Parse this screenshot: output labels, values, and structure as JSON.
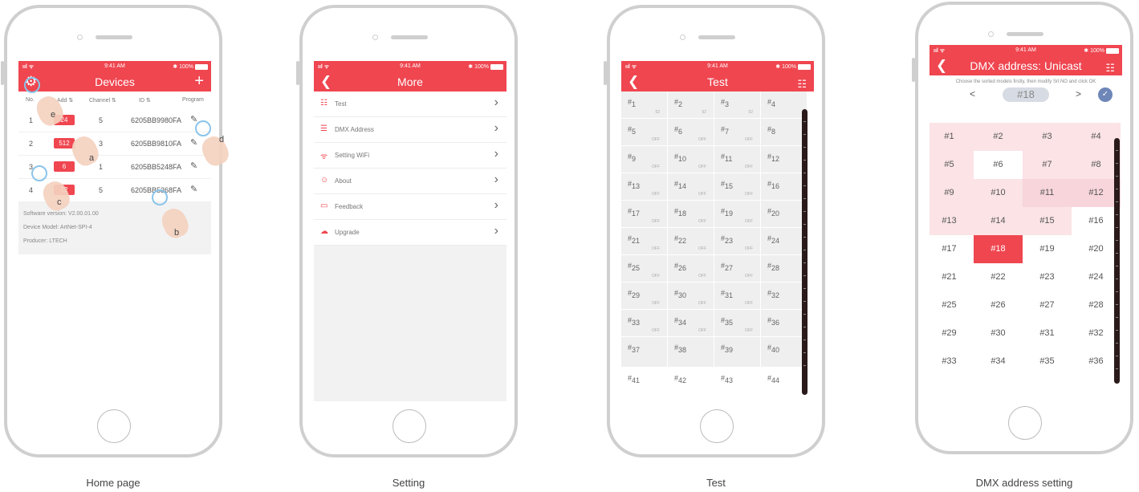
{
  "status": {
    "signal": "ııl ᯤ",
    "time": "9:41 AM",
    "battery": "✱ 100%"
  },
  "home": {
    "caption": "Home page",
    "title": "Devices",
    "col_no": "No.",
    "col_add": "Add ⇅",
    "col_channel": "Channel ⇅",
    "col_id": "ID ⇅",
    "col_program": "Program",
    "devices": [
      {
        "no": "1",
        "addr": "24",
        "channel": "5",
        "id": "6205BB9980FA"
      },
      {
        "no": "2",
        "addr": "512",
        "channel": "3",
        "id": "6205BB9810FA"
      },
      {
        "no": "3",
        "addr": "6",
        "channel": "1",
        "id": "6205BB5248FA"
      },
      {
        "no": "4",
        "addr": "12",
        "channel": "5",
        "id": "6205BB5368FA"
      }
    ],
    "software": "Software version:  V2.00.01.00",
    "model": "Device Model:  ArtNet-SPI-4",
    "producer": "Producer:  LTECH",
    "tags": {
      "a": "a",
      "b": "b",
      "c": "c",
      "d": "d",
      "e": "e"
    }
  },
  "setting": {
    "caption": "Setting",
    "title": "More",
    "items": [
      {
        "label": "Test",
        "icon": "☷"
      },
      {
        "label": "DMX Address",
        "icon": "☰"
      },
      {
        "label": "Setting WiFi",
        "icon": "ᯤ"
      },
      {
        "label": "About",
        "icon": "☺"
      },
      {
        "label": "Feedback",
        "icon": "▭"
      },
      {
        "label": "Upgrade",
        "icon": "☁"
      }
    ]
  },
  "test": {
    "caption": "Test",
    "title": "Test",
    "cells": [
      {
        "n": "1",
        "v": "52"
      },
      {
        "n": "2",
        "v": "52"
      },
      {
        "n": "3",
        "v": "52"
      },
      {
        "n": "4",
        "v": ""
      },
      {
        "n": "5",
        "v": "OFF"
      },
      {
        "n": "6",
        "v": "OFF"
      },
      {
        "n": "7",
        "v": "OFF"
      },
      {
        "n": "8",
        "v": ""
      },
      {
        "n": "9",
        "v": "OFF"
      },
      {
        "n": "10",
        "v": "OFF"
      },
      {
        "n": "11",
        "v": "OFF"
      },
      {
        "n": "12",
        "v": ""
      },
      {
        "n": "13",
        "v": "OFF"
      },
      {
        "n": "14",
        "v": "OFF"
      },
      {
        "n": "15",
        "v": "OFF"
      },
      {
        "n": "16",
        "v": ""
      },
      {
        "n": "17",
        "v": "OFF"
      },
      {
        "n": "18",
        "v": "OFF"
      },
      {
        "n": "19",
        "v": "OFF"
      },
      {
        "n": "20",
        "v": ""
      },
      {
        "n": "21",
        "v": "OFF"
      },
      {
        "n": "22",
        "v": "OFF"
      },
      {
        "n": "23",
        "v": "OFF"
      },
      {
        "n": "24",
        "v": ""
      },
      {
        "n": "25",
        "v": "OFF"
      },
      {
        "n": "26",
        "v": "OFF"
      },
      {
        "n": "27",
        "v": "OFF"
      },
      {
        "n": "28",
        "v": ""
      },
      {
        "n": "29",
        "v": "OFF"
      },
      {
        "n": "30",
        "v": "OFF"
      },
      {
        "n": "31",
        "v": "OFF"
      },
      {
        "n": "32",
        "v": ""
      },
      {
        "n": "33",
        "v": "OFF"
      },
      {
        "n": "34",
        "v": "OFF"
      },
      {
        "n": "35",
        "v": "OFF"
      },
      {
        "n": "36",
        "v": ""
      },
      {
        "n": "37",
        "v": ""
      },
      {
        "n": "38",
        "v": ""
      },
      {
        "n": "39",
        "v": ""
      },
      {
        "n": "40",
        "v": ""
      },
      {
        "n": "41",
        "v": ""
      },
      {
        "n": "42",
        "v": ""
      },
      {
        "n": "43",
        "v": ""
      },
      {
        "n": "44",
        "v": ""
      }
    ]
  },
  "dmx": {
    "caption": "DMX address setting",
    "title": "DMX address: Unicast",
    "hint": "Choose the sorted models firstly,  then modify Srl.NO and click OK",
    "selected": "#18",
    "prev": "<",
    "next": ">",
    "ok": "✓",
    "cells": [
      "#1",
      "#2",
      "#3",
      "#4",
      "#5",
      "#6",
      "#7",
      "#8",
      "#9",
      "#10",
      "#11",
      "#12",
      "#13",
      "#14",
      "#15",
      "#16",
      "#17",
      "#18",
      "#19",
      "#20",
      "#21",
      "#22",
      "#23",
      "#24",
      "#25",
      "#26",
      "#27",
      "#28",
      "#29",
      "#30",
      "#31",
      "#32",
      "#33",
      "#34",
      "#35",
      "#36"
    ],
    "cell_states": [
      "p",
      "p",
      "p",
      "p",
      "p",
      "w",
      "p",
      "p",
      "p",
      "p",
      "d",
      "d",
      "p",
      "p",
      "p",
      "w",
      "w",
      "r",
      "w",
      "w",
      "w",
      "w",
      "w",
      "w",
      "w",
      "w",
      "w",
      "w",
      "w",
      "w",
      "w",
      "w",
      "w",
      "w",
      "w",
      "w"
    ]
  },
  "colors": {
    "accent": "#ef4650",
    "pink": "#fbe3e6",
    "pink_dark": "#f7d5da",
    "test_cell": "#efefef",
    "ok": "#6e86b8"
  }
}
